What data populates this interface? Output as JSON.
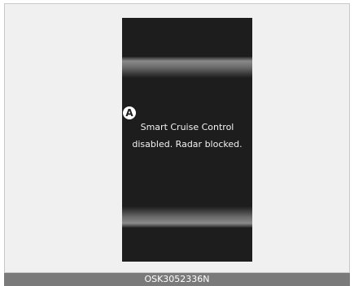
{
  "display": {
    "marker_label": "A",
    "message_line1": "Smart Cruise Control",
    "message_line2": "disabled. Radar blocked."
  },
  "caption": {
    "code": "OSK3052336N"
  }
}
